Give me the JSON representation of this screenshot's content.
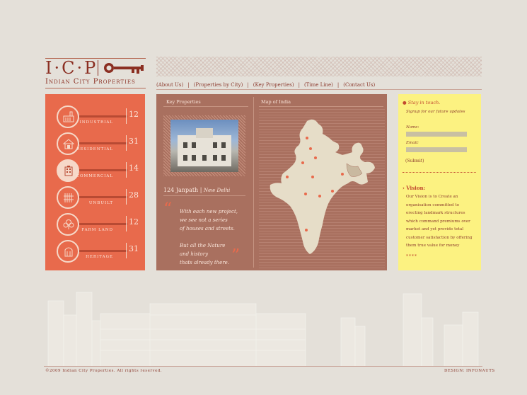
{
  "brand": {
    "logo_text": "I·C·P",
    "name": "Indian City Properties"
  },
  "nav": {
    "items": [
      "(About Us)",
      "(Properties by City)",
      "(Key Properties)",
      "(Time Line)",
      "(Contact Us)"
    ],
    "separator": "|"
  },
  "categories": [
    {
      "label": "Industrial",
      "count": "12",
      "icon": "factory-icon"
    },
    {
      "label": "Residential",
      "count": "31",
      "icon": "house-icon"
    },
    {
      "label": "Commercial",
      "count": "14",
      "icon": "office-building-icon"
    },
    {
      "label": "Unbuilt",
      "count": "28",
      "icon": "fence-icon"
    },
    {
      "label": "Farm Land",
      "count": "12",
      "icon": "trees-icon"
    },
    {
      "label": "Heritage",
      "count": "31",
      "icon": "heritage-building-icon"
    }
  ],
  "key_properties": {
    "title": "Key Properties",
    "property_name": "124 Janpath",
    "property_city": "New Delhi",
    "quote": "With each new project,\nwe see not a series\nof houses and streets.\n\nBut all the Nature\nand history\nthats already there.",
    "quote_open": "“",
    "quote_close": "”"
  },
  "map": {
    "title": "Map of India"
  },
  "contact": {
    "title": "Stay in touch.",
    "subtitle": "Signup for our future updates",
    "name_label": "Name:",
    "email_label": "Email:",
    "submit_label": "(Submit)"
  },
  "vision": {
    "title": "Vision:",
    "text": "Our Vision is to Create an organisation committed to erecting landmark structures which command premiums over market and yet provide total customer satisfaction by offering them true value for money",
    "stars": "****"
  },
  "footer": {
    "copyright": "©2009 Indian City Properties. All rights reserved.",
    "design": "Design: Infonauts"
  },
  "colors": {
    "background": "#e4e0d9",
    "category_panel": "#e86a4c",
    "middle_panel": "#a9705f",
    "right_panel": "#fcf281",
    "text_brown": "#8b3a2e"
  }
}
